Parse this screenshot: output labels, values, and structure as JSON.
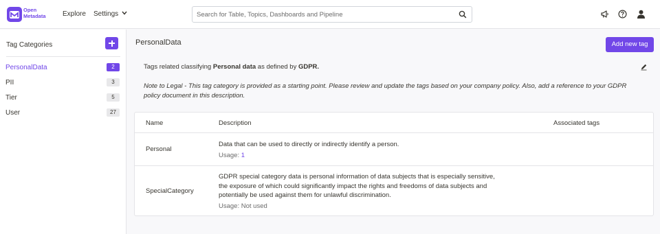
{
  "brand": {
    "logo_line1": "Open",
    "logo_line2": "Metadata",
    "accent": "#7147e8"
  },
  "nav": {
    "explore": "Explore",
    "settings": "Settings"
  },
  "search": {
    "placeholder": "Search for Table, Topics, Dashboards and Pipeline",
    "value": ""
  },
  "top_icons": [
    "megaphone-icon",
    "help-icon",
    "user-avatar-icon"
  ],
  "sidebar": {
    "title": "Tag Categories",
    "items": [
      {
        "label": "PersonalData",
        "count": "2",
        "active": true
      },
      {
        "label": "PII",
        "count": "3",
        "active": false
      },
      {
        "label": "Tier",
        "count": "5",
        "active": false
      },
      {
        "label": "User",
        "count": "27",
        "active": false
      }
    ]
  },
  "main": {
    "title": "PersonalData",
    "add_button": "Add new tag",
    "description": {
      "prefix": "Tags related classifying ",
      "bold1": "Personal data",
      "middle": " as defined by ",
      "bold2": "GDPR."
    },
    "note": "Note to Legal - This tag category is provided as a starting point. Please review and update the tags based on your company policy. Also, add a reference to your GDPR policy document in this description.",
    "table": {
      "headers": {
        "name": "Name",
        "description": "Description",
        "associated": "Associated tags"
      },
      "rows": [
        {
          "name": "Personal",
          "description": "Data that can be used to directly or indirectly identify a person.",
          "usage_label": "Usage: ",
          "usage_value": "1"
        },
        {
          "name": "SpecialCategory",
          "description_lines": [
            "GDPR special category data is personal information of data subjects that is especially sensitive,",
            "the exposure of which could significantly impact the rights and freedoms of data subjects and",
            "potentially be used against them for unlawful discrimination."
          ],
          "usage_label": "Usage: ",
          "usage_value": "Not used"
        }
      ]
    }
  }
}
